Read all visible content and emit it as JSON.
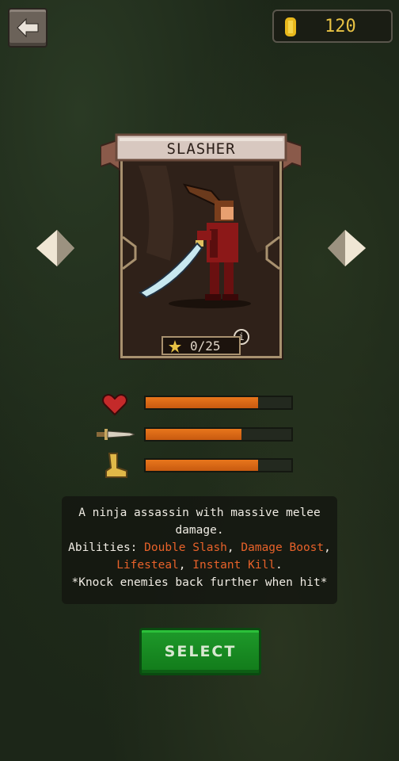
{
  "header": {
    "back_icon": "arrow-left-icon",
    "coins": "120",
    "coin_icon": "gold-coin-icon"
  },
  "character": {
    "name": "SLASHER",
    "progress": "0/25",
    "progress_icon": "star-icon",
    "info_label": "i"
  },
  "navigation": {
    "prev_icon": "diamond-arrow-left-icon",
    "next_icon": "diamond-arrow-right-icon"
  },
  "stats": [
    {
      "icon": "heart-icon",
      "level": 0.77
    },
    {
      "icon": "dagger-icon",
      "level": 0.66
    },
    {
      "icon": "boot-icon",
      "level": 0.77
    }
  ],
  "description": {
    "line1": "A ninja assassin with massive melee",
    "line2": "damage.",
    "abilities_label": "Abilities: ",
    "ability1": "Double Slash",
    "ability2": "Damage Boost",
    "ability3": "Lifesteal",
    "ability4": "Instant Kill",
    "comma": ", ",
    "period": ".",
    "bonus": "*Knock enemies back further when hit*"
  },
  "select_label": "SELECT",
  "colors": {
    "accent_orange": "#e8761c",
    "ability_color": "#e8622a",
    "select_green": "#1e9a2a",
    "coin_gold": "#e8c244"
  }
}
